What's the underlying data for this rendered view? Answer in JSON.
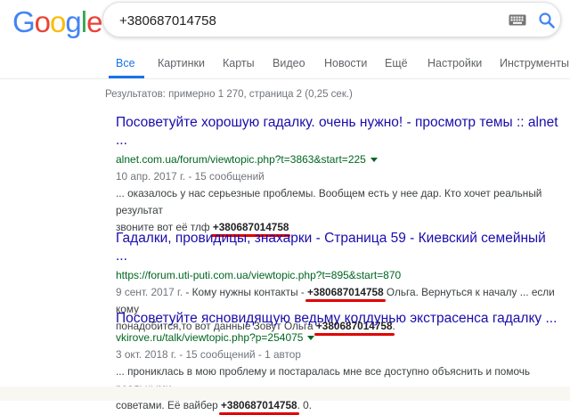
{
  "logo": {
    "letters": [
      "G",
      "o",
      "o",
      "g",
      "l",
      "e"
    ],
    "colors": [
      "#4285F4",
      "#EA4335",
      "#FBBC05",
      "#4285F4",
      "#34A853",
      "#EA4335"
    ]
  },
  "search": {
    "query": "+380687014758",
    "keyboard_icon": "keyboard-icon",
    "search_icon": "magnifier-icon"
  },
  "tabs": [
    "Все",
    "Картинки",
    "Карты",
    "Видео",
    "Новости",
    "Ещё",
    "Настройки",
    "Инструменты"
  ],
  "active_tab": "Все",
  "stats": "Результатов: примерно 1 270, страница 2 (0,25 сек.)",
  "accent_color": "#1a73e8",
  "highlight_color": "#e00000",
  "results": [
    {
      "title_line1": "Посоветуйте хорошую гадалку. очень нужно! - просмотр темы :: alnet",
      "title_line2": "...",
      "url": "alnet.com.ua/forum/viewtopic.php?t=3863&start=225",
      "date": "10 апр. 2017 г. - 15 сообщений",
      "snippet_line1": "... оказалось у нас серьезные проблемы. Вообщем есть у нее дар. Кто хочет реальный результат",
      "snippet_line2_pre": "звоните вот её тлф ",
      "phone": "+380687014758"
    },
    {
      "title_line1": "Гадалки, провидицы, знахарки - Страница 59 - Киевский семейный ...",
      "url": "https://forum.uti-puti.com.ua/viewtopic.php?t=895&start=870",
      "date": "9 сент. 2017 г.",
      "snippet_line1_a": " - Кому нужны контакты - ",
      "phone": "+380687014758",
      "snippet_line1_b": " Ольга. Вернуться к началу ... если кому",
      "snippet_line2_pre": "понадобится,то вот данные Зовут Ольга ",
      "phone2": "+380687014758",
      "snippet_line2_post": "."
    },
    {
      "title_line1": "Посоветуйте ясновидящую ведьму колдунью экстрасенса гадалку ...",
      "url": "vkirove.ru/talk/viewtopic.php?p=254075",
      "date": "3 окт. 2018 г. - 15 сообщений - 1 автор",
      "snippet_line1": "... прониклась в мою проблему и постаралась мне все доступно объяснить и помочь реальными",
      "snippet_line2_pre": "советами. Её вайбер ",
      "phone": "+380687014758",
      "snippet_line2_post": ". 0."
    }
  ]
}
